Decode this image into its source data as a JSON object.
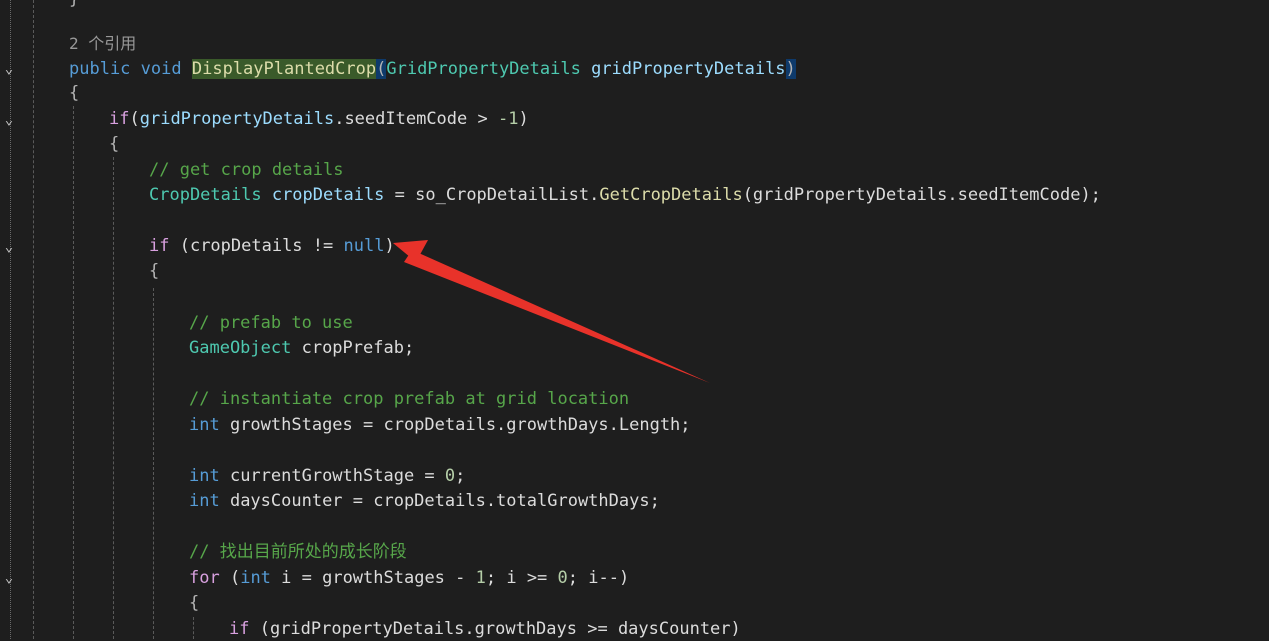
{
  "editor": {
    "ref_count": "2 个引用",
    "lines": {
      "l0": "}",
      "sig_kw_public": "public",
      "sig_kw_void": "void",
      "sig_fn": "DisplayPlantedCrop",
      "sig_open": "(",
      "sig_type": "GridPropertyDetails",
      "sig_param": "gridPropertyDetails",
      "sig_close": ")",
      "brace_open": "{",
      "if_kw": "if",
      "if1_rest_a": "(",
      "if1_var": "gridPropertyDetails",
      "if1_rest_b": ".seedItemCode > ",
      "if1_num": "-1",
      "if1_close": ")",
      "cmt_get": "// get crop details",
      "cd_type": "CropDetails",
      "cd_var": " cropDetails",
      "cd_eq": " = ",
      "cd_so": "so_CropDetailList",
      "cd_dot": ".",
      "cd_fn": "GetCropDetails",
      "cd_args": "(gridPropertyDetails.seedItemCode);",
      "if2_rest": " (cropDetails != ",
      "if2_null": "null",
      "if2_close": ")",
      "cmt_prefab": "// prefab to use",
      "go_type": "GameObject",
      "go_var": " cropPrefab;",
      "cmt_inst": "// instantiate crop prefab at grid location",
      "int_kw": "int",
      "gs_rest": " growthStages = cropDetails.growthDays.Length;",
      "cgs_rest": " currentGrowthStage = ",
      "cgs_num": "0",
      "cgs_end": ";",
      "dc_rest": " daysCounter = cropDetails.totalGrowthDays;",
      "cmt_find": "// 找出目前所处的成长阶段",
      "for_kw": "for",
      "for_a": " (",
      "for_b": " i = growthStages - ",
      "for_num1": "1",
      "for_c": "; i >= ",
      "for_num2": "0",
      "for_d": "; i--)",
      "if3_rest": " (gridPropertyDetails.growthDays >= daysCounter)"
    }
  },
  "colors": {
    "background": "#1e1e1e",
    "keyword": "#569cd6",
    "control": "#d8a0df",
    "type": "#4ec9b0",
    "function": "#dcdcaa",
    "comment": "#57a64a",
    "number": "#b5cea8",
    "arrow": "#e8322a"
  },
  "icons": [
    "fold-chevron-icon",
    "red-arrow-annotation-icon"
  ]
}
